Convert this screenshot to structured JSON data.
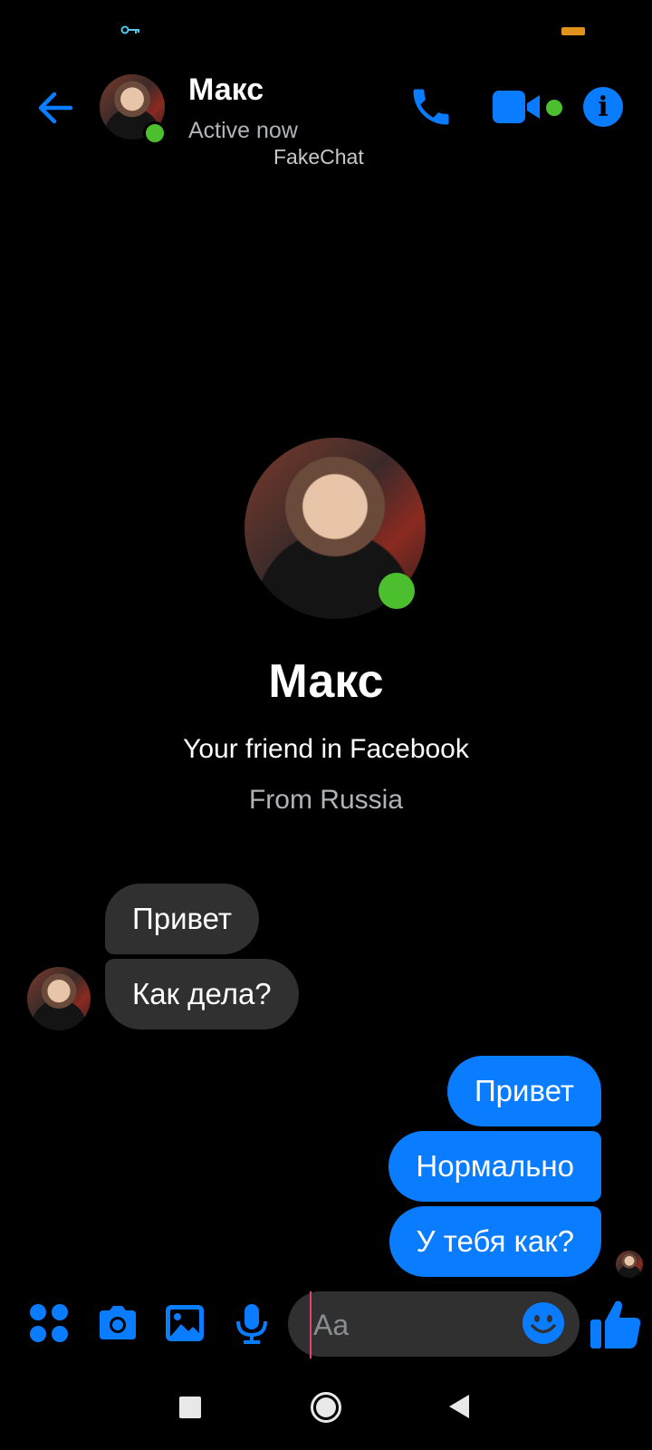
{
  "status_bar": {
    "icons": [
      "key-icon",
      "battery-icon"
    ]
  },
  "header": {
    "name": "Макс",
    "status": "Active now",
    "watermark": "FakeChat",
    "icons": [
      "back-arrow-icon",
      "phone-icon",
      "video-camera-icon",
      "info-icon"
    ],
    "accent": "#0a7cff",
    "online_color": "#4cbf2f"
  },
  "profile": {
    "name": "Макс",
    "subtitle": "Your friend in Facebook",
    "location": "From Russia"
  },
  "messages": {
    "incoming": [
      "Привет",
      "Как дела?"
    ],
    "outgoing": [
      "Привет",
      "Нормально",
      "У тебя как?"
    ],
    "incoming_color": "#303030",
    "outgoing_color": "#0a7cff"
  },
  "composer": {
    "placeholder": "Aa",
    "icons": [
      "apps-grid-icon",
      "camera-icon",
      "image-icon",
      "microphone-icon",
      "emoji-icon",
      "thumbs-up-icon"
    ]
  },
  "nav_bar": {
    "icons": [
      "recent-apps-icon",
      "home-icon",
      "back-triangle-icon"
    ]
  }
}
